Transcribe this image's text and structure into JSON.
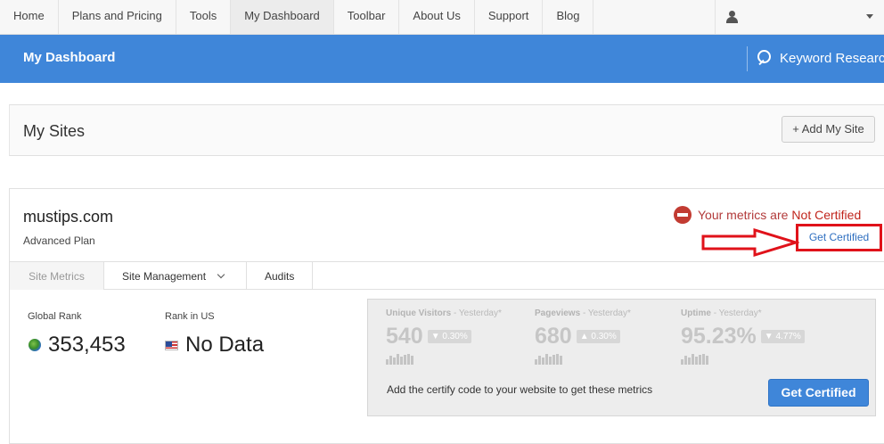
{
  "topnav": {
    "items": [
      "Home",
      "Plans and Pricing",
      "Tools",
      "My Dashboard",
      "Toolbar",
      "About Us",
      "Support",
      "Blog"
    ],
    "active": "My Dashboard"
  },
  "header": {
    "title": "My Dashboard",
    "keyword_research": "Keyword Research"
  },
  "sites": {
    "heading": "My Sites",
    "add_button": "+ Add My Site"
  },
  "site": {
    "name": "mustips.com",
    "plan": "Advanced Plan",
    "cert_status_prefix": "Your metrics are",
    "cert_status": "Not Certified",
    "get_certified_link": "Get Certified",
    "tabs": [
      "Site Metrics",
      "Site Management",
      "Audits"
    ],
    "global_rank_label": "Global Rank",
    "global_rank_value": "353,453",
    "us_rank_label": "Rank in US",
    "us_rank_value": "No Data"
  },
  "metrics": {
    "unique_visitors": {
      "label": "Unique Visitors",
      "period": "- Yesterday*",
      "value": "540",
      "change": "▼ 0.30%"
    },
    "pageviews": {
      "label": "Pageviews",
      "period": "- Yesterday*",
      "value": "680",
      "change": "▲ 0.30%"
    },
    "uptime": {
      "label": "Uptime",
      "period": "- Yesterday*",
      "value": "95.23%",
      "change": "▼ 4.77%"
    },
    "certify_message": "Add the certify code to your website to get these metrics",
    "certify_button": "Get Certified"
  },
  "colors": {
    "brand_blue": "#3f86d9",
    "annotation_red": "#e0121a",
    "warning_red": "#c0241b"
  }
}
